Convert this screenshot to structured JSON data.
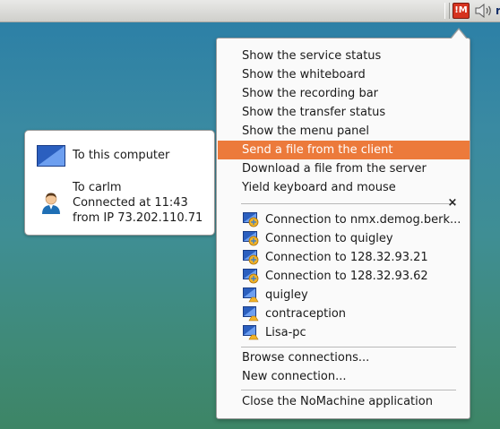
{
  "tray": {
    "nomachine_label": "!M",
    "clipped_text": "r"
  },
  "balloon": {
    "target_label": "To this computer",
    "user_line": "To carlm",
    "connected_line": "Connected at 11:43",
    "ip_line": "from IP  73.202.110.71"
  },
  "menu": {
    "items_top": [
      "Show the service status",
      "Show the whiteboard",
      "Show the recording bar",
      "Show the transfer status",
      "Show the menu panel",
      "Send a file from the client",
      "Download a file from the server",
      "Yield keyboard and mouse"
    ],
    "highlighted_index": 5,
    "close_glyph": "×",
    "connections": [
      {
        "label": "Connection to nmx.demog.berk...",
        "kind": "active"
      },
      {
        "label": "Connection to quigley",
        "kind": "active"
      },
      {
        "label": "Connection to 128.32.93.21",
        "kind": "active"
      },
      {
        "label": "Connection to 128.32.93.62",
        "kind": "active"
      },
      {
        "label": "quigley",
        "kind": "user"
      },
      {
        "label": "contraception",
        "kind": "user"
      },
      {
        "label": "Lisa-pc",
        "kind": "user"
      }
    ],
    "browse_label": "Browse connections...",
    "new_label": "New connection...",
    "close_app_label": "Close the NoMachine application"
  },
  "colors": {
    "highlight": "#ec7a3b",
    "tray_icon": "#d6331f",
    "desktop_top": "#2a7ea7",
    "desktop_bottom": "#3d8566"
  }
}
